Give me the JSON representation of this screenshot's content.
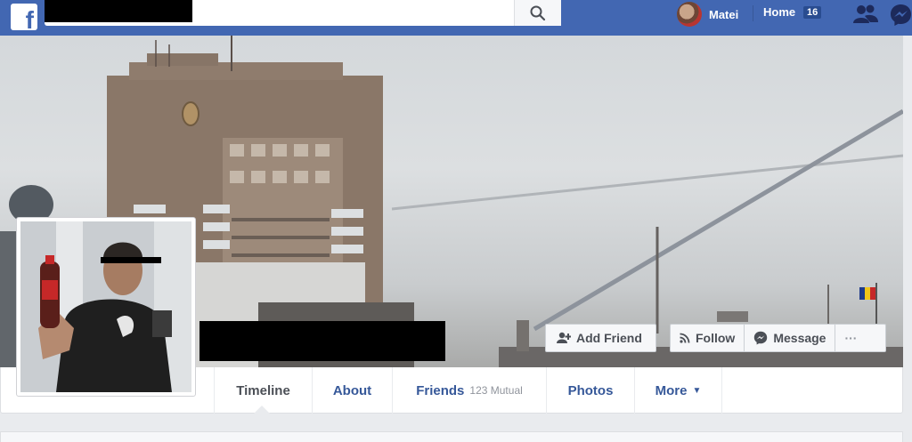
{
  "topbar": {
    "profile_name": "Matei",
    "home_label": "Home",
    "home_count": "16",
    "brand_color": "#4267b2"
  },
  "cover_actions": {
    "add_friend_label": "Add Friend",
    "follow_label": "Follow",
    "message_label": "Message",
    "more_label": "···"
  },
  "tabs": {
    "timeline": "Timeline",
    "about": "About",
    "friends": "Friends",
    "friends_mutual": "123 Mutual",
    "photos": "Photos",
    "more": "More",
    "more_arrow": "▼"
  },
  "icons": {
    "logo": "facebook-logo-icon",
    "search": "search-icon",
    "friends": "friend-requests-icon",
    "messenger": "messenger-icon",
    "add_friend": "add-friend-icon",
    "follow": "rss-icon",
    "message": "messenger-bubble-icon"
  }
}
